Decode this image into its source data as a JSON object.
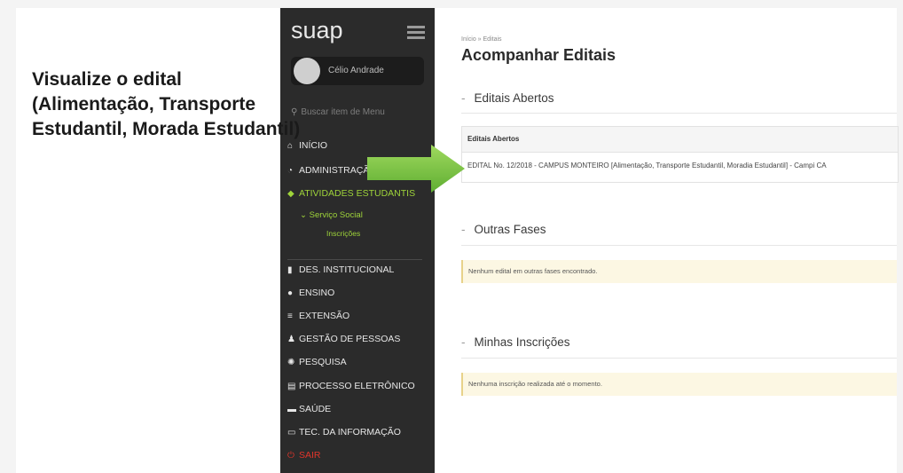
{
  "caption": {
    "line1": "Visualize o edital",
    "line2": "(Alimentação, Transporte",
    "line3": "Estudantil, Morada Estudantil)"
  },
  "sidebar": {
    "logo": "suap",
    "user_name": "Célio Andrade",
    "search_placeholder": "Buscar item de Menu",
    "items": [
      {
        "label": "INÍCIO",
        "icon": "home-icon"
      },
      {
        "label": "ADMINISTRAÇÃO",
        "icon": "gauge-icon"
      },
      {
        "label": "ATIVIDADES ESTUDANTIS",
        "icon": "graduation-cap-icon"
      },
      {
        "label": "DES. INSTITUCIONAL",
        "icon": "bar-chart-icon"
      },
      {
        "label": "ENSINO",
        "icon": "check-circle-icon"
      },
      {
        "label": "EXTENSÃO",
        "icon": "layers-icon"
      },
      {
        "label": "GESTÃO DE PESSOAS",
        "icon": "user-icon"
      },
      {
        "label": "PESQUISA",
        "icon": "atom-icon"
      },
      {
        "label": "PROCESSO ELETRÔNICO",
        "icon": "document-icon"
      },
      {
        "label": "SAÚDE",
        "icon": "medkit-icon"
      },
      {
        "label": "TEC. DA INFORMAÇÃO",
        "icon": "monitor-icon"
      },
      {
        "label": "SAIR",
        "icon": "power-icon"
      }
    ],
    "sub_item": "Serviço Social",
    "sub_sub_item": "Inscrições",
    "active_color": "#9fd43a",
    "exit_color": "#e0352b"
  },
  "main": {
    "breadcrumb": "Início » Editais",
    "title": "Acompanhar Editais",
    "sections": {
      "open": "Editais Abertos",
      "other": "Outras Fases",
      "mine": "Minhas Inscrições"
    },
    "table": {
      "header": "Editais Abertos",
      "row": "EDITAL No. 12/2018 - CAMPUS MONTEIRO [Alimentação, Transporte Estudantil, Moradia Estudantil] - Campi CA"
    },
    "alerts": {
      "other": "Nenhum edital em outras fases encontrado.",
      "mine": "Nenhuma inscrição realizada até o momento."
    }
  },
  "colors": {
    "arrow": "#7cc24a",
    "sidebar_bg": "#2b2b2b"
  }
}
